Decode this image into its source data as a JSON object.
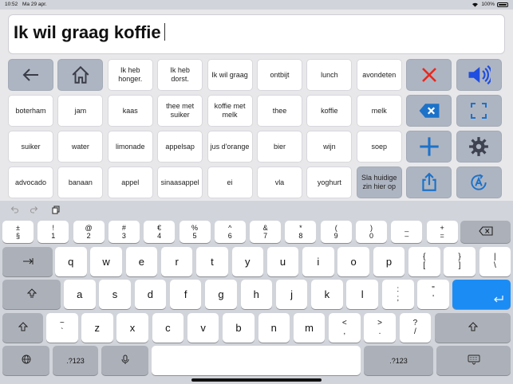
{
  "status_bar": {
    "time": "10:52",
    "date": "Ma 29 apr.",
    "battery_text": "100%"
  },
  "message": {
    "text": "Ik wil graag koffie"
  },
  "tiles": [
    {
      "name": "tile-back",
      "icon": "arrow-left-icon",
      "gray": true
    },
    {
      "name": "tile-home",
      "icon": "home-icon",
      "gray": true
    },
    {
      "name": "tile-ik-heb-honger",
      "label": "Ik heb honger."
    },
    {
      "name": "tile-ik-heb-dorst",
      "label": "Ik heb dorst."
    },
    {
      "name": "tile-ik-wil-graag",
      "label": "Ik wil graag"
    },
    {
      "name": "tile-ontbijt",
      "label": "ontbijt"
    },
    {
      "name": "tile-lunch",
      "label": "lunch"
    },
    {
      "name": "tile-avondeten",
      "label": "avondeten"
    },
    {
      "name": "tile-clear",
      "icon": "close-icon",
      "gray": true,
      "color": "#e8281e"
    },
    {
      "name": "tile-speak",
      "icon": "speaker-icon",
      "gray": true,
      "color": "#1f4ee0"
    },
    {
      "name": "tile-boterham",
      "label": "boterham"
    },
    {
      "name": "tile-jam",
      "label": "jam"
    },
    {
      "name": "tile-kaas",
      "label": "kaas"
    },
    {
      "name": "tile-thee-met-suiker",
      "label": "thee met suiker"
    },
    {
      "name": "tile-koffie-met-melk",
      "label": "koffie met melk"
    },
    {
      "name": "tile-thee",
      "label": "thee"
    },
    {
      "name": "tile-koffie",
      "label": "koffie"
    },
    {
      "name": "tile-melk",
      "label": "melk"
    },
    {
      "name": "tile-backspace",
      "icon": "backspace-icon",
      "gray": true,
      "color": "#1c72c9"
    },
    {
      "name": "tile-fullscreen",
      "icon": "fullscreen-icon",
      "gray": true,
      "color": "#1c72c9"
    },
    {
      "name": "tile-suiker",
      "label": "suiker"
    },
    {
      "name": "tile-water",
      "label": "water"
    },
    {
      "name": "tile-limonade",
      "label": "limonade"
    },
    {
      "name": "tile-appelsap",
      "label": "appelsap"
    },
    {
      "name": "tile-jus-dorange",
      "label": "jus d'orange"
    },
    {
      "name": "tile-bier",
      "label": "bier"
    },
    {
      "name": "tile-wijn",
      "label": "wijn"
    },
    {
      "name": "tile-soep",
      "label": "soep"
    },
    {
      "name": "tile-add",
      "icon": "plus-icon",
      "gray": true,
      "color": "#1c72c9"
    },
    {
      "name": "tile-settings",
      "icon": "gear-icon",
      "gray": true,
      "color": "#3d4150"
    },
    {
      "name": "tile-advocado",
      "label": "advocado"
    },
    {
      "name": "tile-banaan",
      "label": "banaan"
    },
    {
      "name": "tile-appel",
      "label": "appel"
    },
    {
      "name": "tile-sinaasappel",
      "label": "sinaasappel"
    },
    {
      "name": "tile-ei",
      "label": "ei"
    },
    {
      "name": "tile-vla",
      "label": "vla"
    },
    {
      "name": "tile-yoghurt",
      "label": "yoghurt"
    },
    {
      "name": "tile-save-sentence",
      "label": "Sla huidige zin hier op",
      "gray": true
    },
    {
      "name": "tile-share",
      "icon": "share-icon",
      "gray": true,
      "color": "#1c72c9"
    },
    {
      "name": "tile-voice",
      "icon": "voice-icon",
      "gray": true,
      "color": "#1c72c9"
    }
  ],
  "keyboard": {
    "number_row": [
      {
        "top": "±",
        "bottom": "§"
      },
      {
        "top": "!",
        "bottom": "1"
      },
      {
        "top": "@",
        "bottom": "2"
      },
      {
        "top": "#",
        "bottom": "3"
      },
      {
        "top": "€",
        "bottom": "4"
      },
      {
        "top": "%",
        "bottom": "5"
      },
      {
        "top": "^",
        "bottom": "6"
      },
      {
        "top": "&",
        "bottom": "7"
      },
      {
        "top": "*",
        "bottom": "8"
      },
      {
        "top": "(",
        "bottom": "9"
      },
      {
        "top": ")",
        "bottom": "0"
      },
      {
        "top": "_",
        "bottom": "–"
      },
      {
        "top": "+",
        "bottom": "="
      }
    ],
    "row_q": [
      "q",
      "w",
      "e",
      "r",
      "t",
      "y",
      "u",
      "i",
      "o",
      "p"
    ],
    "row_q_extra": [
      {
        "top": "{",
        "bottom": "["
      },
      {
        "top": "}",
        "bottom": "]"
      },
      {
        "top": "|",
        "bottom": "\\"
      }
    ],
    "row_a": [
      "a",
      "s",
      "d",
      "f",
      "g",
      "h",
      "j",
      "k",
      "l"
    ],
    "row_a_extra": [
      {
        "top": ":",
        "bottom": ";"
      },
      {
        "top": "\"",
        "bottom": "'"
      }
    ],
    "row_z_first": {
      "top": "~",
      "bottom": "`"
    },
    "row_z": [
      "z",
      "x",
      "c",
      "v",
      "b",
      "n",
      "m"
    ],
    "row_z_extra": [
      {
        "top": "<",
        "bottom": ","
      },
      {
        "top": ">",
        "bottom": "."
      },
      {
        "top": "?",
        "bottom": "/"
      }
    ],
    "numbers_label": ".?123"
  }
}
